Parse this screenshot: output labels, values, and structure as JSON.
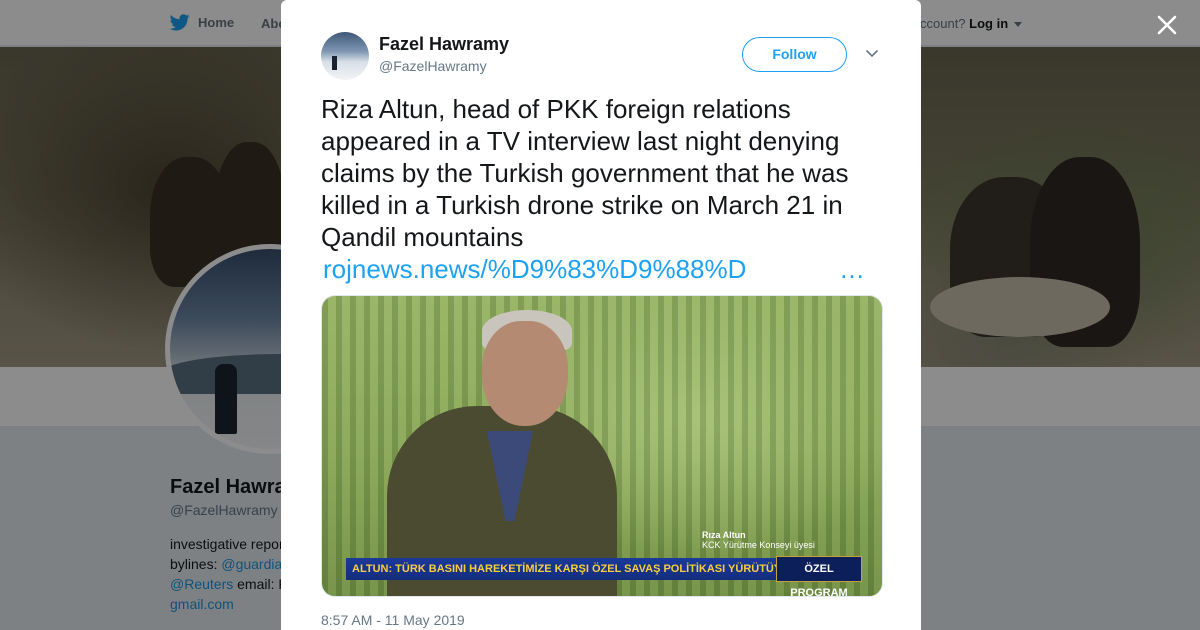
{
  "background_page": {
    "nav": {
      "home_label": "Home",
      "about_label": "Abo",
      "account_prompt": "ccount?",
      "login_label": "Log in"
    },
    "profile": {
      "name": "Fazel Hawra",
      "handle": "@FazelHawramy",
      "bio_line1": "investigative repor",
      "bio_line2_prefix": "bylines: ",
      "bio_line2_link": "@guardia",
      "bio_line3_link": "@Reuters",
      "bio_line3_suffix": " email: F",
      "bio_line4_link": "gmail.com"
    }
  },
  "tweet": {
    "author_name": "Fazel Hawramy",
    "author_handle": "@FazelHawramy",
    "follow_label": "Follow",
    "text": "Riza Altun, head of PKK foreign relations appeared in a TV interview last night denying claims by the Turkish government that he was killed in a Turkish drone strike on March 21 in Qandil mountains",
    "link_text": "rojnews.news/%D9%83%D9%88%D",
    "link_ellipsis": "…",
    "media": {
      "caption_name": "Rıza Altun",
      "caption_subtitle": "KCK Yürütme Konseyi üyesi",
      "ticker_text": "ALTUN: TÜRK BASINI HAREKETİMİZE KARŞI ÖZEL SAVAŞ POLİTİKASI YÜRÜTÜYOR",
      "program_label": "ÖZEL PROGRAM"
    },
    "timestamp": "8:57 AM - 11 May 2019"
  },
  "icons": [
    "twitter-bird-icon",
    "close-icon",
    "chevron-down-icon",
    "dropdown-caret-icon"
  ],
  "colors": {
    "accent": "#1da1f2",
    "text": "#14171a",
    "secondary_text": "#657786",
    "overlay": "rgba(0,0,0,0.45)"
  }
}
